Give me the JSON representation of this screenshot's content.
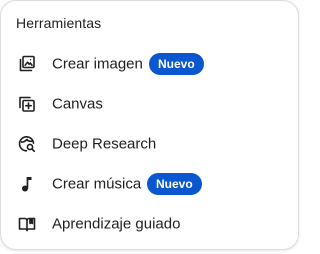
{
  "menu": {
    "title": "Herramientas",
    "badge_color": "#0b57d0",
    "items": [
      {
        "label": "Crear imagen",
        "icon": "create-image-icon",
        "badge": "Nuevo"
      },
      {
        "label": "Canvas",
        "icon": "canvas-icon"
      },
      {
        "label": "Deep Research",
        "icon": "deep-research-icon"
      },
      {
        "label": "Crear música",
        "icon": "music-note-icon",
        "badge": "Nuevo"
      },
      {
        "label": "Aprendizaje guiado",
        "icon": "guided-learning-icon"
      }
    ]
  }
}
